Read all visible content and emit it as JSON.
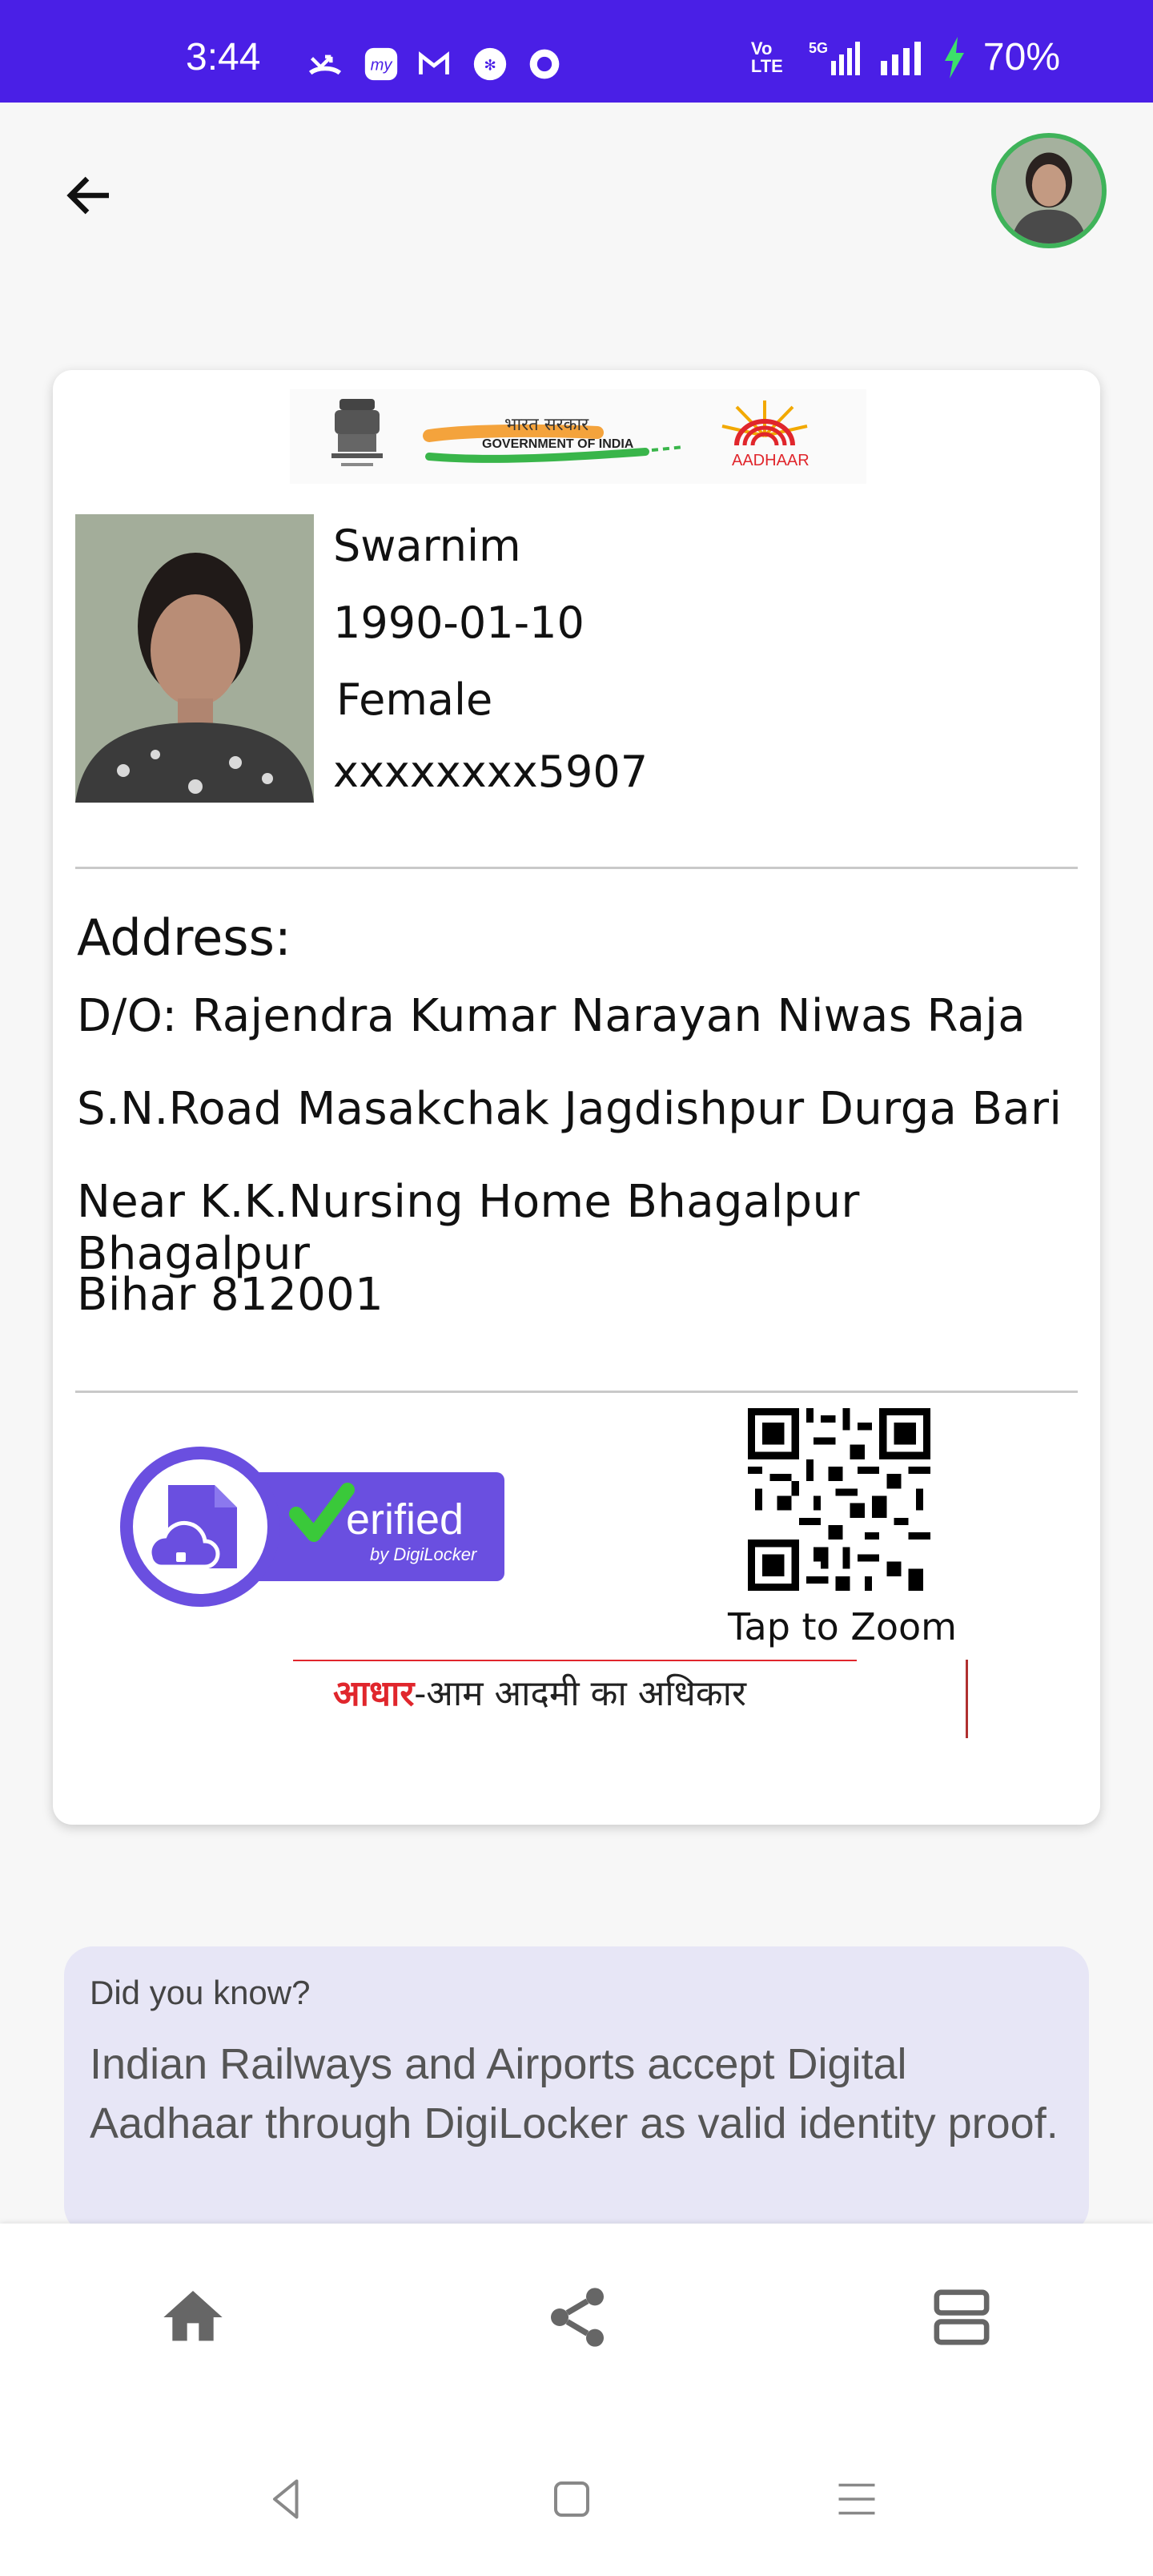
{
  "status_bar": {
    "time": "3:44",
    "network_volte": "Vo LTE",
    "network_5g": "5G",
    "battery": "70%"
  },
  "top_bar": {
    "back_icon": "arrow-left-icon",
    "avatar": "user-avatar"
  },
  "card": {
    "header": {
      "gov_hindi": "भारत सरकार",
      "gov_english": "GOVERNMENT OF INDIA",
      "aadhaar_logo_text": "AADHAAR"
    },
    "name": "Swarnim",
    "dob": "1990-01-10",
    "gender": "Female",
    "aadhaar_number": "xxxxxxxx5907",
    "address_title": "Address:",
    "address_lines": [
      "D/O: Rajendra Kumar Narayan Niwas Raja",
      "S.N.Road Masakchak Jagdishpur Durga Bari",
      "Near K.K.Nursing Home Bhagalpur Bhagalpur",
      "Bihar 812001"
    ],
    "verified": {
      "text": "erified",
      "sub": "by DigiLocker"
    },
    "qr_label": "Tap to Zoom",
    "slogan_red": "आधार",
    "slogan_rest": "-आम आदमी का अधिकार"
  },
  "info": {
    "heading": "Did you know?",
    "body": "Indian Railways and Airports accept Digital Aadhaar through DigiLocker as valid identity proof."
  },
  "bottom_nav": [
    "home-icon",
    "share-icon",
    "view-agenda-icon"
  ],
  "system_nav": [
    "back-triangle-icon",
    "home-square-icon",
    "menu-lines-icon"
  ],
  "colors": {
    "status_bar": "#4a1fe6",
    "verified_purple": "#6a4fe0",
    "check_green": "#3ac93a",
    "banner": "#e7e6f6"
  }
}
